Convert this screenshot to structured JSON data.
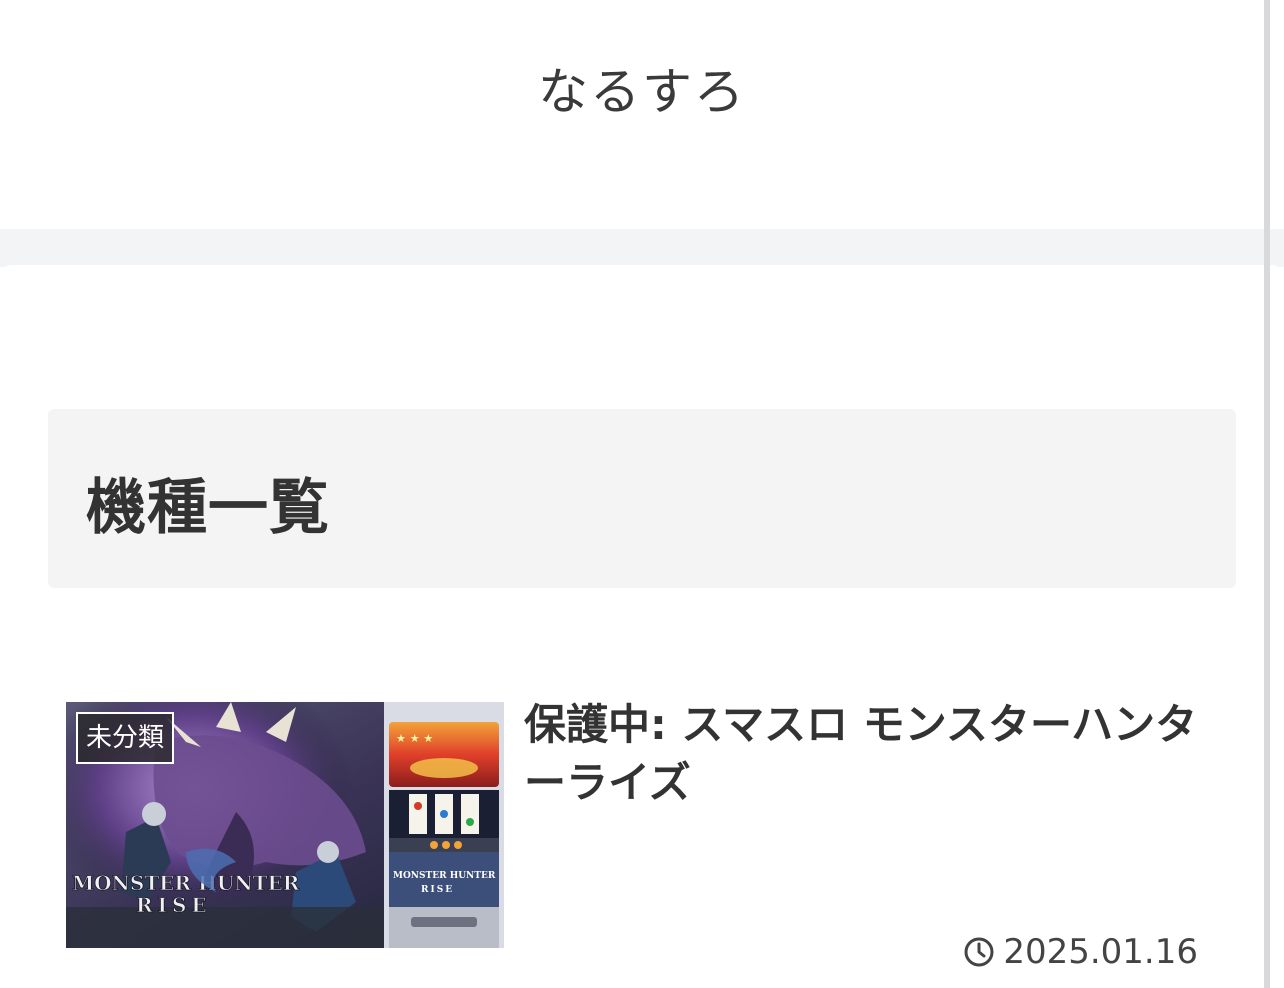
{
  "site": {
    "title": "なるすろ"
  },
  "archive": {
    "title": "機種一覧"
  },
  "entries": [
    {
      "category": "未分類",
      "title": "保護中: スマスロ モンスターハンターライズ",
      "date": "2025.01.16",
      "date_icon": "clock-icon",
      "thumbnail_text": {
        "logo_line1": "MONSTER HUNTER",
        "logo_line2": "RISE",
        "cabinet_logo_line1": "MONSTER HUNTER",
        "cabinet_logo_line2": "RISE"
      }
    }
  ],
  "colors": {
    "background": "#ffffff",
    "gap_band": "#f3f4f6",
    "archive_header_bg": "#f4f4f5",
    "text": "#333333",
    "scrollbar": "#d9d9dc"
  }
}
